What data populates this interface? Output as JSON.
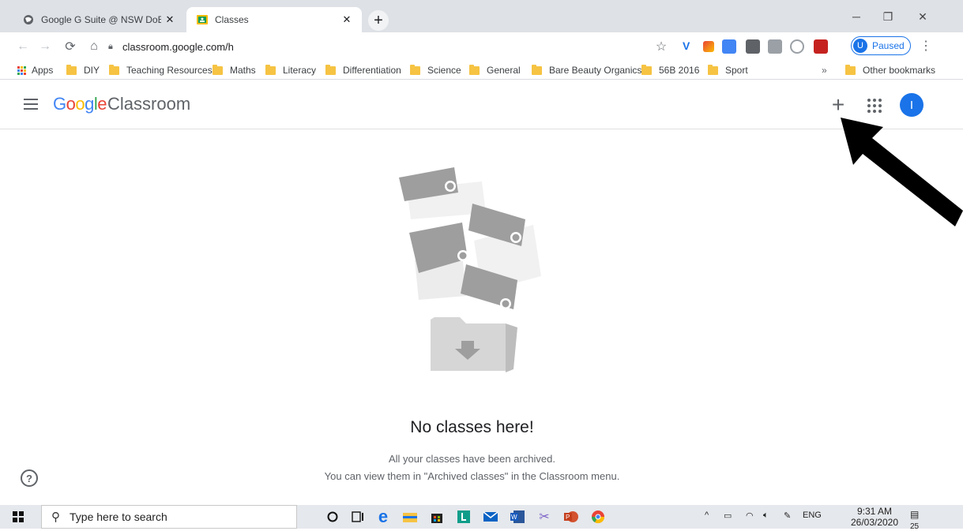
{
  "browser": {
    "tabs": [
      {
        "title": "Google G Suite @ NSW DoE",
        "icon": "globe-icon",
        "active": false
      },
      {
        "title": "Classes",
        "icon": "classroom-icon",
        "active": true
      }
    ],
    "url": "classroom.google.com/h",
    "profile": {
      "initial": "U",
      "status": "Paused"
    }
  },
  "bookmarks": {
    "apps_label": "Apps",
    "items": [
      "DIY",
      "Teaching Resources",
      "Maths",
      "Literacy",
      "Differentiation",
      "Science",
      "General",
      "Bare Beauty Organics",
      "56B 2016",
      "Sport"
    ],
    "overflow": "»",
    "other": "Other bookmarks"
  },
  "header": {
    "brand_google": "Google",
    "brand_product": "Classroom",
    "add_symbol": "+",
    "avatar_initial": "I"
  },
  "empty_state": {
    "title": "No classes here!",
    "line1": "All your classes have been archived.",
    "line2": "You can view them in \"Archived classes\" in the Classroom menu."
  },
  "help_symbol": "?",
  "taskbar": {
    "search_placeholder": "Type here to search",
    "language": "ENG",
    "time": "9:31 AM",
    "date": "26/03/2020",
    "notification_count": "25"
  },
  "colors": {
    "accent_blue": "#1a73e8",
    "google_blue": "#4285f4",
    "google_red": "#ea4335",
    "google_yellow": "#fbbc04",
    "google_green": "#34a853",
    "folder_yellow": "#f6c343"
  }
}
